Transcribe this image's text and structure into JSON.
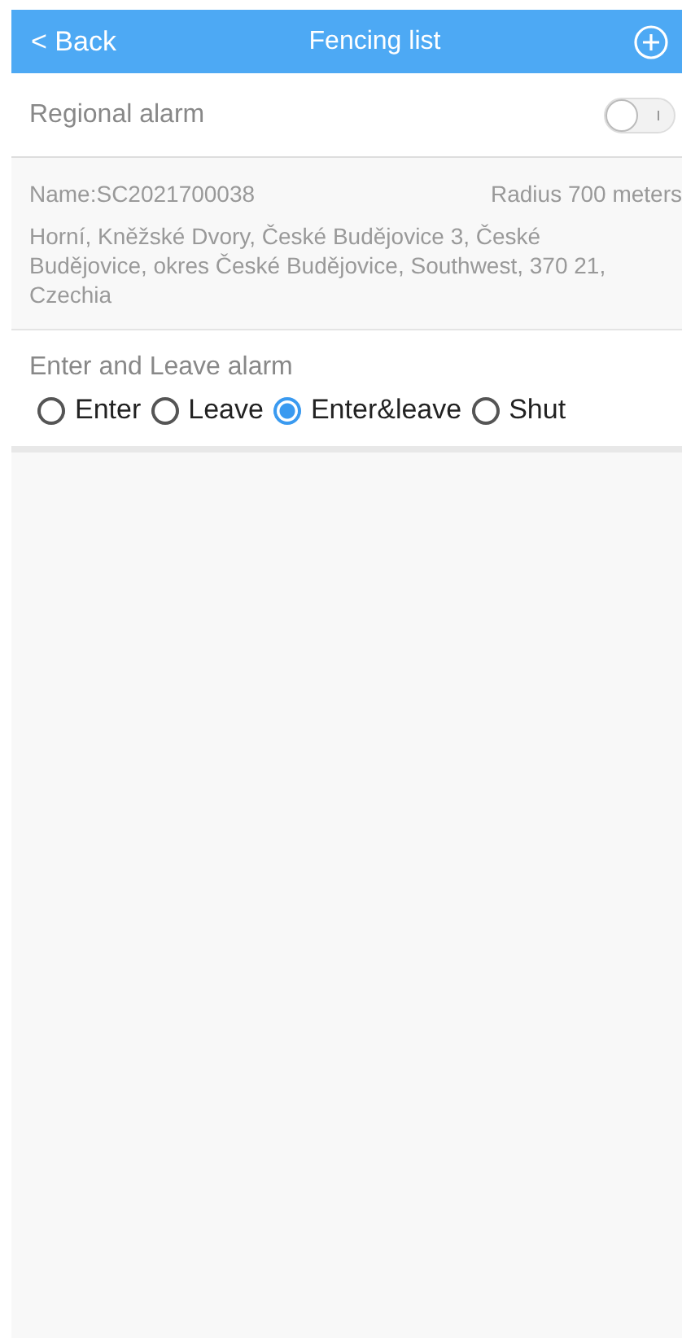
{
  "header": {
    "back": "< Back",
    "title": "Fencing list"
  },
  "regional_alarm": {
    "label": "Regional alarm",
    "on": false
  },
  "fence": {
    "name": "Name:SC2021700038",
    "radius": "Radius 700 meters",
    "address": "Horní, Kněžské Dvory, České Budějovice 3, České Budějovice, okres České Budějovice, Southwest, 370 21, Czechia"
  },
  "alarm_mode": {
    "title": "Enter and Leave alarm",
    "options": [
      {
        "label": "Enter",
        "selected": false
      },
      {
        "label": "Leave",
        "selected": false
      },
      {
        "label": "Enter&leave",
        "selected": true
      },
      {
        "label": "Shut",
        "selected": false
      }
    ]
  }
}
